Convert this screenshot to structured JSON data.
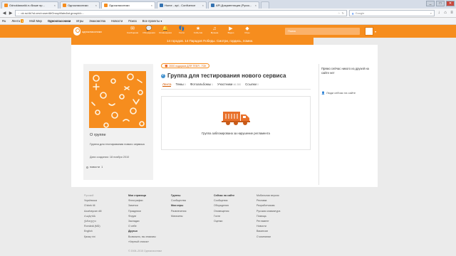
{
  "browser": {
    "tabs": [
      {
        "label": "Odnoklassniki.ru Ваше пр...",
        "color": "#f68d1e"
      },
      {
        "label": "Одноклассники",
        "color": "#f68d1e"
      },
      {
        "label": "Одноклассники",
        "color": "#f68d1e"
      },
      {
        "label": "Home - api - Confluence",
        "color": "#3572b0"
      },
      {
        "label": "API.Документация (Русск...",
        "color": "#3572b0"
      }
    ],
    "url": "ok.ru/dk?st.cmd=userAltGroupMain&st.groupId=...",
    "search_placeholder": "Google",
    "winbtns": [
      "_",
      "□",
      "✕"
    ]
  },
  "bookmarks": [
    {
      "label": "Ru"
    },
    {
      "label": "Лента",
      "badge": "1"
    },
    {
      "label": "Мой Мир"
    },
    {
      "label": "Одноклассники",
      "bold": true
    },
    {
      "label": "Игры"
    },
    {
      "label": "Знакомства"
    },
    {
      "label": "Новости"
    },
    {
      "label": "Поиск"
    },
    {
      "label": "Все проекты ▾"
    }
  ],
  "okbar": {
    "logo": "одноклассники",
    "items": [
      {
        "label": "Сообщения",
        "icon": "envelope-icon",
        "glyph": "✉"
      },
      {
        "label": "Обсуждения",
        "icon": "chat-icon",
        "glyph": "💬"
      },
      {
        "label": "Оповещения",
        "icon": "bell-icon",
        "glyph": "🔔"
      },
      {
        "label": "Гости",
        "icon": "footprints-icon",
        "glyph": "👣"
      },
      {
        "label": "События",
        "icon": "star-icon",
        "glyph": "★"
      },
      {
        "label": "Музыка",
        "icon": "music-icon",
        "glyph": "♫"
      },
      {
        "label": "Видео",
        "icon": "video-icon",
        "glyph": "▶"
      },
      {
        "label": "Игры",
        "icon": "games-icon",
        "glyph": "◆"
      }
    ],
    "search_placeholder": "Поиск"
  },
  "banner": {
    "text": "14 городов. 14 Парадов Победы. Смотри, гордись, помни."
  },
  "promo": {
    "text": "2000 подарков ДЛЯ ТЕБЯ - ТОК"
  },
  "group": {
    "title": "Группа для тестирования нового сервиса",
    "tabs": [
      {
        "label": "Лента",
        "active": true
      },
      {
        "label": "Темы",
        "count": "0"
      },
      {
        "label": "Фотоальбомы",
        "count": "1"
      },
      {
        "label": "Участники",
        "count": "46 280"
      },
      {
        "label": "Ссылки",
        "count": "0"
      }
    ],
    "blocked_text": "Группа заблокирована за нарушение регламента"
  },
  "about": {
    "title": "О группе",
    "description": "Группа для тестирования нового сервиса",
    "created": "Дата создания: 18 ноября 2010",
    "news_label": "новости",
    "news_count": "1"
  },
  "right": {
    "note": "Прямо сейчас никого из друзей на сайте нет",
    "link": "Люди сейчас на сайте"
  },
  "footer": {
    "columns": [
      {
        "items": [
          {
            "t": "Русский",
            "muted": true
          },
          {
            "t": "Українська"
          },
          {
            "t": "O'zbek tili"
          },
          {
            "t": "Azərbaycan dili"
          },
          {
            "t": "Հայերեն"
          },
          {
            "t": "ქართული"
          },
          {
            "t": "Română (MD)"
          },
          {
            "t": "English"
          },
          {
            "t": "Қазақ тілі"
          }
        ]
      },
      {
        "items": [
          {
            "t": "Моя страница",
            "h": true
          },
          {
            "t": "Фотографии"
          },
          {
            "t": "Заметки"
          },
          {
            "t": "Праздники"
          },
          {
            "t": "Форум"
          },
          {
            "t": "Закладки"
          },
          {
            "t": "О себе"
          },
          {
            "t": "Друзья",
            "h": true
          },
          {
            "t": "Возможно, вы знакомы"
          },
          {
            "t": "«Черный список»"
          }
        ]
      },
      {
        "items": [
          {
            "t": "Группы",
            "h": true
          },
          {
            "t": "Сообщества"
          },
          {
            "t": "Мои игры",
            "h": true
          },
          {
            "t": "Развлечения"
          },
          {
            "t": "Магазины"
          }
        ]
      },
      {
        "items": [
          {
            "t": "Сейчас на сайте",
            "h": true
          },
          {
            "t": "Сообщения"
          },
          {
            "t": "Обсуждения"
          },
          {
            "t": "Оповещения"
          },
          {
            "t": "Гости"
          },
          {
            "t": "Оценки"
          }
        ]
      },
      {
        "items": [
          {
            "t": "Мобильная версия"
          },
          {
            "t": "Реклама"
          },
          {
            "t": "Разработчикам"
          },
          {
            "t": "Русская клавиатура"
          },
          {
            "t": "Помощь"
          },
          {
            "t": "Регламент"
          },
          {
            "t": "Новости"
          },
          {
            "t": "Вакансии"
          },
          {
            "t": "О компании"
          }
        ]
      }
    ],
    "copyright": "© 2006–2015 Одноклассники"
  }
}
